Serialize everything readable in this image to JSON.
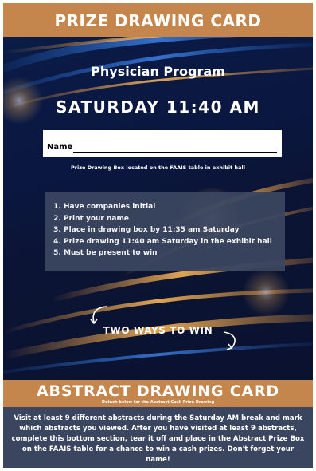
{
  "header": {
    "title": "PRIZE DRAWING CARD"
  },
  "program": {
    "name": "Physician Program",
    "time": "SATURDAY 11:40 AM"
  },
  "name_field": {
    "label": "Name"
  },
  "box_note": "Prize Drawing Box located on the FAAIS table in exhibit hall",
  "steps": [
    "Have companies initial",
    "Print your name",
    "Place in drawing box by 11:35 am Saturday",
    "Prize drawing 11:40 am Saturday in the exhibit hall",
    "Must be present to win"
  ],
  "ways_to_win": "TWO WAYS TO WIN",
  "abstract": {
    "title": "ABSTRACT DRAWING CARD",
    "detach_note": "Detach below for the Abstract Cash Prize Drawing",
    "instructions": "Visit at least 9 different abstracts during the Saturday AM break and mark which abstracts you viewed. After you have visited at least 9 abstracts, complete this bottom section, tear it off and place in the Abstract Prize Box on the FAAIS table for a chance to win a cash prizes. Don't forget your name!"
  },
  "colors": {
    "band": "#c4864c",
    "panel": "#3a4660",
    "background": "#0b1434",
    "streak": "#f0a040"
  }
}
